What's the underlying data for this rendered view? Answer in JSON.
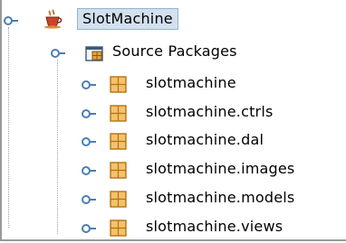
{
  "tree": {
    "project": {
      "label": "SlotMachine",
      "icon": "coffee-cup-icon",
      "selected": true,
      "expanded": true
    },
    "source_packages": {
      "label": "Source Packages",
      "icon": "source-packages-icon",
      "expanded": true
    },
    "packages": [
      {
        "label": "slotmachine",
        "icon": "package-icon"
      },
      {
        "label": "slotmachine.ctrls",
        "icon": "package-icon"
      },
      {
        "label": "slotmachine.dal",
        "icon": "package-icon"
      },
      {
        "label": "slotmachine.images",
        "icon": "package-icon"
      },
      {
        "label": "slotmachine.models",
        "icon": "package-icon"
      },
      {
        "label": "slotmachine.views",
        "icon": "package-icon"
      }
    ]
  },
  "colors": {
    "selection_background": "#d3e0ee",
    "selection_border": "#97b2cf",
    "handle_blue": "#4a7fb5",
    "package_orange": "#e6a23c",
    "guide_line": "#9aa3ad"
  }
}
